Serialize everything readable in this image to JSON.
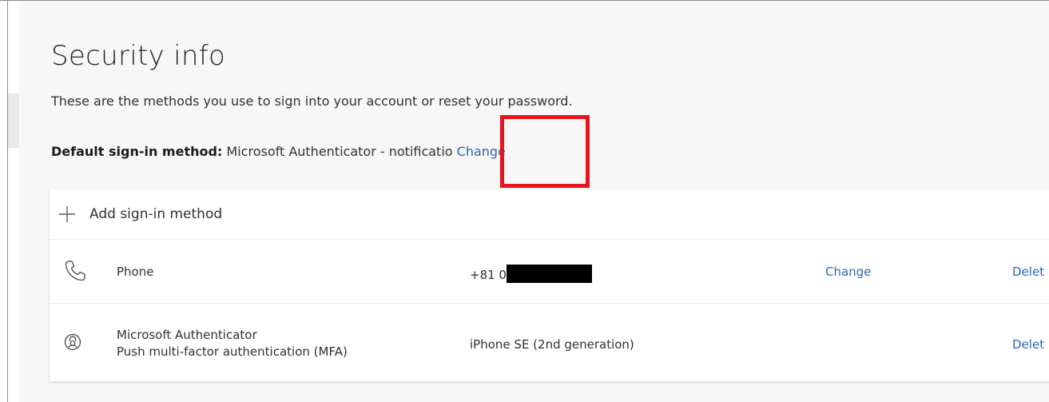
{
  "header": {
    "title": "Security info",
    "description": "These are the methods you use to sign into your account or reset your password."
  },
  "default_method": {
    "label": "Default sign-in method:",
    "value": "Microsoft Authenticator - notificatio",
    "change_link": "Change"
  },
  "methods_card": {
    "add_label": "Add sign-in method",
    "rows": [
      {
        "icon": "phone-icon",
        "name": "Phone",
        "detail_prefix": "+81 0",
        "detail_redacted": true,
        "change_link": "Change",
        "delete_link": "Delet"
      },
      {
        "icon": "authenticator-lock-icon",
        "name": "Microsoft Authenticator",
        "subtitle": "Push multi-factor authentication (MFA)",
        "detail": "iPhone SE (2nd generation)",
        "delete_link": "Delet"
      }
    ]
  },
  "colors": {
    "link": "#2b69b6",
    "highlight": "#e8141b",
    "background": "#f7f7f7",
    "card": "#ffffff"
  }
}
